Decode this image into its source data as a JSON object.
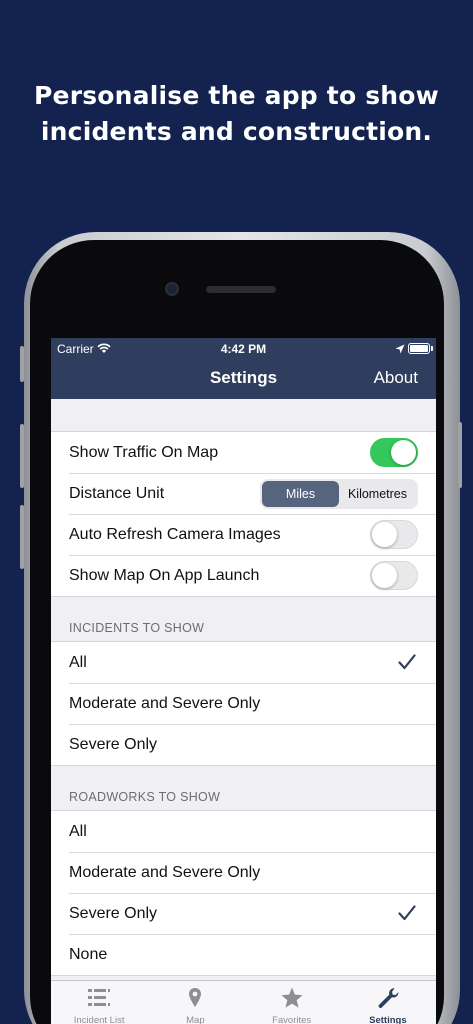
{
  "headline": {
    "line1": "Personalise the app to show",
    "line2": "incidents and construction."
  },
  "status_bar": {
    "carrier": "Carrier",
    "time": "4:42 PM"
  },
  "navbar": {
    "title": "Settings",
    "about_label": "About",
    "background": "#2f3e5e"
  },
  "settings": {
    "show_traffic": {
      "label": "Show Traffic On Map",
      "on": true
    },
    "distance_unit": {
      "label": "Distance Unit",
      "options": [
        "Miles",
        "Kilometres"
      ],
      "selected": "Miles"
    },
    "auto_refresh": {
      "label": "Auto Refresh Camera Images",
      "on": false
    },
    "show_map_launch": {
      "label": "Show Map On App Launch",
      "on": false
    }
  },
  "incidents": {
    "header": "INCIDENTS TO SHOW",
    "options": [
      "All",
      "Moderate and Severe Only",
      "Severe Only"
    ],
    "selected": "All"
  },
  "roadworks": {
    "header": "ROADWORKS TO SHOW",
    "options": [
      "All",
      "Moderate and Severe Only",
      "Severe Only",
      "None"
    ],
    "selected": "Severe Only"
  },
  "tabbar": {
    "tabs": [
      {
        "label": "Incident List",
        "icon": "list-icon"
      },
      {
        "label": "Map",
        "icon": "map-pin-icon"
      },
      {
        "label": "Favorites",
        "icon": "star-icon"
      },
      {
        "label": "Settings",
        "icon": "wrench-icon"
      }
    ],
    "active": "Settings"
  },
  "colors": {
    "background": "#13224f",
    "toggle_on": "#34c759",
    "segment_active": "#56647d",
    "checkmark": "#2f3e5e"
  }
}
